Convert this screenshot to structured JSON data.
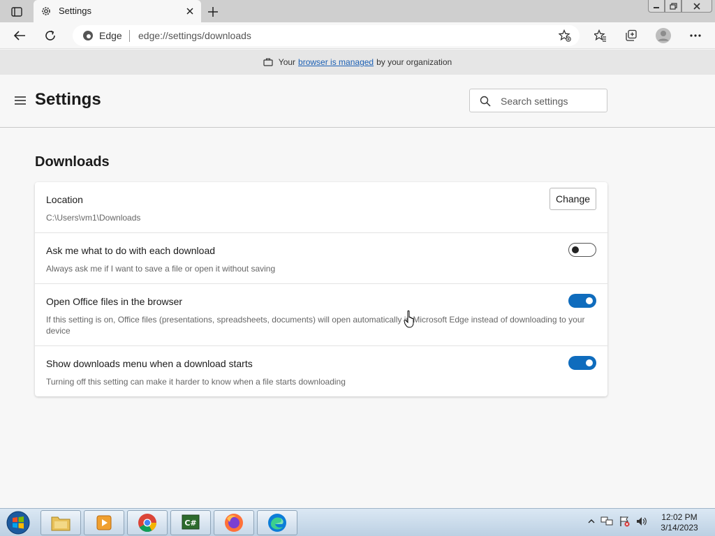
{
  "browser": {
    "tab_title": "Settings",
    "omnibox_label": "Edge",
    "url": "edge://settings/downloads"
  },
  "managed_bar": {
    "prefix": "Your",
    "link": "browser is managed",
    "suffix": "by your organization"
  },
  "header": {
    "title": "Settings",
    "search_placeholder": "Search settings"
  },
  "section": {
    "title": "Downloads"
  },
  "settings": {
    "location": {
      "title": "Location",
      "path": "C:\\Users\\vm1\\Downloads",
      "button": "Change"
    },
    "ask": {
      "title": "Ask me what to do with each download",
      "desc": "Always ask me if I want to save a file or open it without saving",
      "state": "off"
    },
    "office": {
      "title": "Open Office files in the browser",
      "desc": "If this setting is on, Office files (presentations, spreadsheets, documents) will open automatically in Microsoft Edge instead of downloading to your device",
      "state": "on"
    },
    "menu": {
      "title": "Show downloads menu when a download starts",
      "desc": "Turning off this setting can make it harder to know when a file starts downloading",
      "state": "on"
    }
  },
  "taskbar": {
    "time": "12:02 PM",
    "date": "3/14/2023"
  },
  "colors": {
    "accent": "#0f6cbd",
    "link": "#1a5fb4"
  }
}
